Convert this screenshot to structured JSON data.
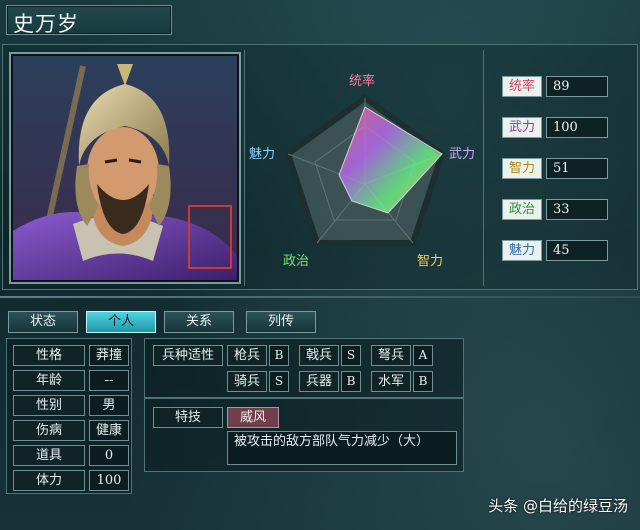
{
  "officer": {
    "name": "史万岁"
  },
  "radar": {
    "labels": {
      "leadership": "统率",
      "war": "武力",
      "intelligence": "智力",
      "politics": "政治",
      "charisma": "魅力"
    },
    "label_colors": {
      "leadership": "#ff7aa6",
      "war": "#cfa7ff",
      "intelligence": "#f5d24a",
      "politics": "#7ee07a",
      "charisma": "#8fd0ff"
    }
  },
  "stats": [
    {
      "label": "统率",
      "value": "89",
      "color": "#d9435e"
    },
    {
      "label": "武力",
      "value": "100",
      "color": "#8a3aa8"
    },
    {
      "label": "智力",
      "value": "51",
      "color": "#b08a12"
    },
    {
      "label": "政治",
      "value": "33",
      "color": "#2f8f3a"
    },
    {
      "label": "魅力",
      "value": "45",
      "color": "#2f6fa8"
    }
  ],
  "tabs": [
    {
      "label": "状态",
      "active": false
    },
    {
      "label": "个人",
      "active": true
    },
    {
      "label": "关系",
      "active": false
    },
    {
      "label": "列传",
      "active": false
    }
  ],
  "personal": [
    {
      "label": "性格",
      "value": "莽撞"
    },
    {
      "label": "年龄",
      "value": "--"
    },
    {
      "label": "性别",
      "value": "男"
    },
    {
      "label": "伤病",
      "value": "健康"
    },
    {
      "label": "道具",
      "value": "0"
    },
    {
      "label": "体力",
      "value": "100"
    }
  ],
  "troops": {
    "header": "兵种适性",
    "items": [
      {
        "name": "枪兵",
        "grade": "B"
      },
      {
        "name": "戟兵",
        "grade": "S"
      },
      {
        "name": "弩兵",
        "grade": "A"
      },
      {
        "name": "骑兵",
        "grade": "S"
      },
      {
        "name": "兵器",
        "grade": "B"
      },
      {
        "name": "水军",
        "grade": "B"
      }
    ]
  },
  "skill": {
    "label": "特技",
    "name": "威风",
    "description": "被攻击的敌方部队气力减少（大）"
  },
  "seal_text": "史万岁",
  "watermark": "头条 @白给的绿豆汤"
}
